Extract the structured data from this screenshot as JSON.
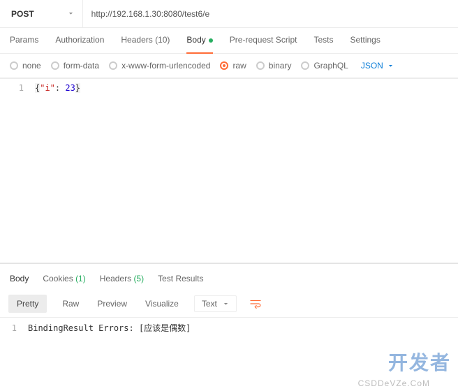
{
  "request": {
    "method": "POST",
    "url": "http://192.168.1.30:8080/test6/e"
  },
  "tabs": {
    "params": "Params",
    "authorization": "Authorization",
    "headers": "Headers (10)",
    "body": "Body",
    "prerequest": "Pre-request Script",
    "tests": "Tests",
    "settings": "Settings"
  },
  "body_types": {
    "none": "none",
    "formdata": "form-data",
    "urlencoded": "x-www-form-urlencoded",
    "raw": "raw",
    "binary": "binary",
    "graphql": "GraphQL",
    "format": "JSON"
  },
  "editor": {
    "line_no": "1",
    "json_key": "\"i\"",
    "json_val": "23"
  },
  "response_tabs": {
    "body": "Body",
    "cookies": "Cookies",
    "cookies_count": "(1)",
    "headers": "Headers",
    "headers_count": "(5)",
    "test_results": "Test Results"
  },
  "response_toolbar": {
    "pretty": "Pretty",
    "raw": "Raw",
    "preview": "Preview",
    "visualize": "Visualize",
    "text": "Text"
  },
  "response_body": {
    "line_no": "1",
    "text": "BindingResult Errors: [应该是偶数]"
  },
  "watermarks": {
    "brand": "开发者",
    "csdn": "CSDDeVZe.CoM"
  }
}
